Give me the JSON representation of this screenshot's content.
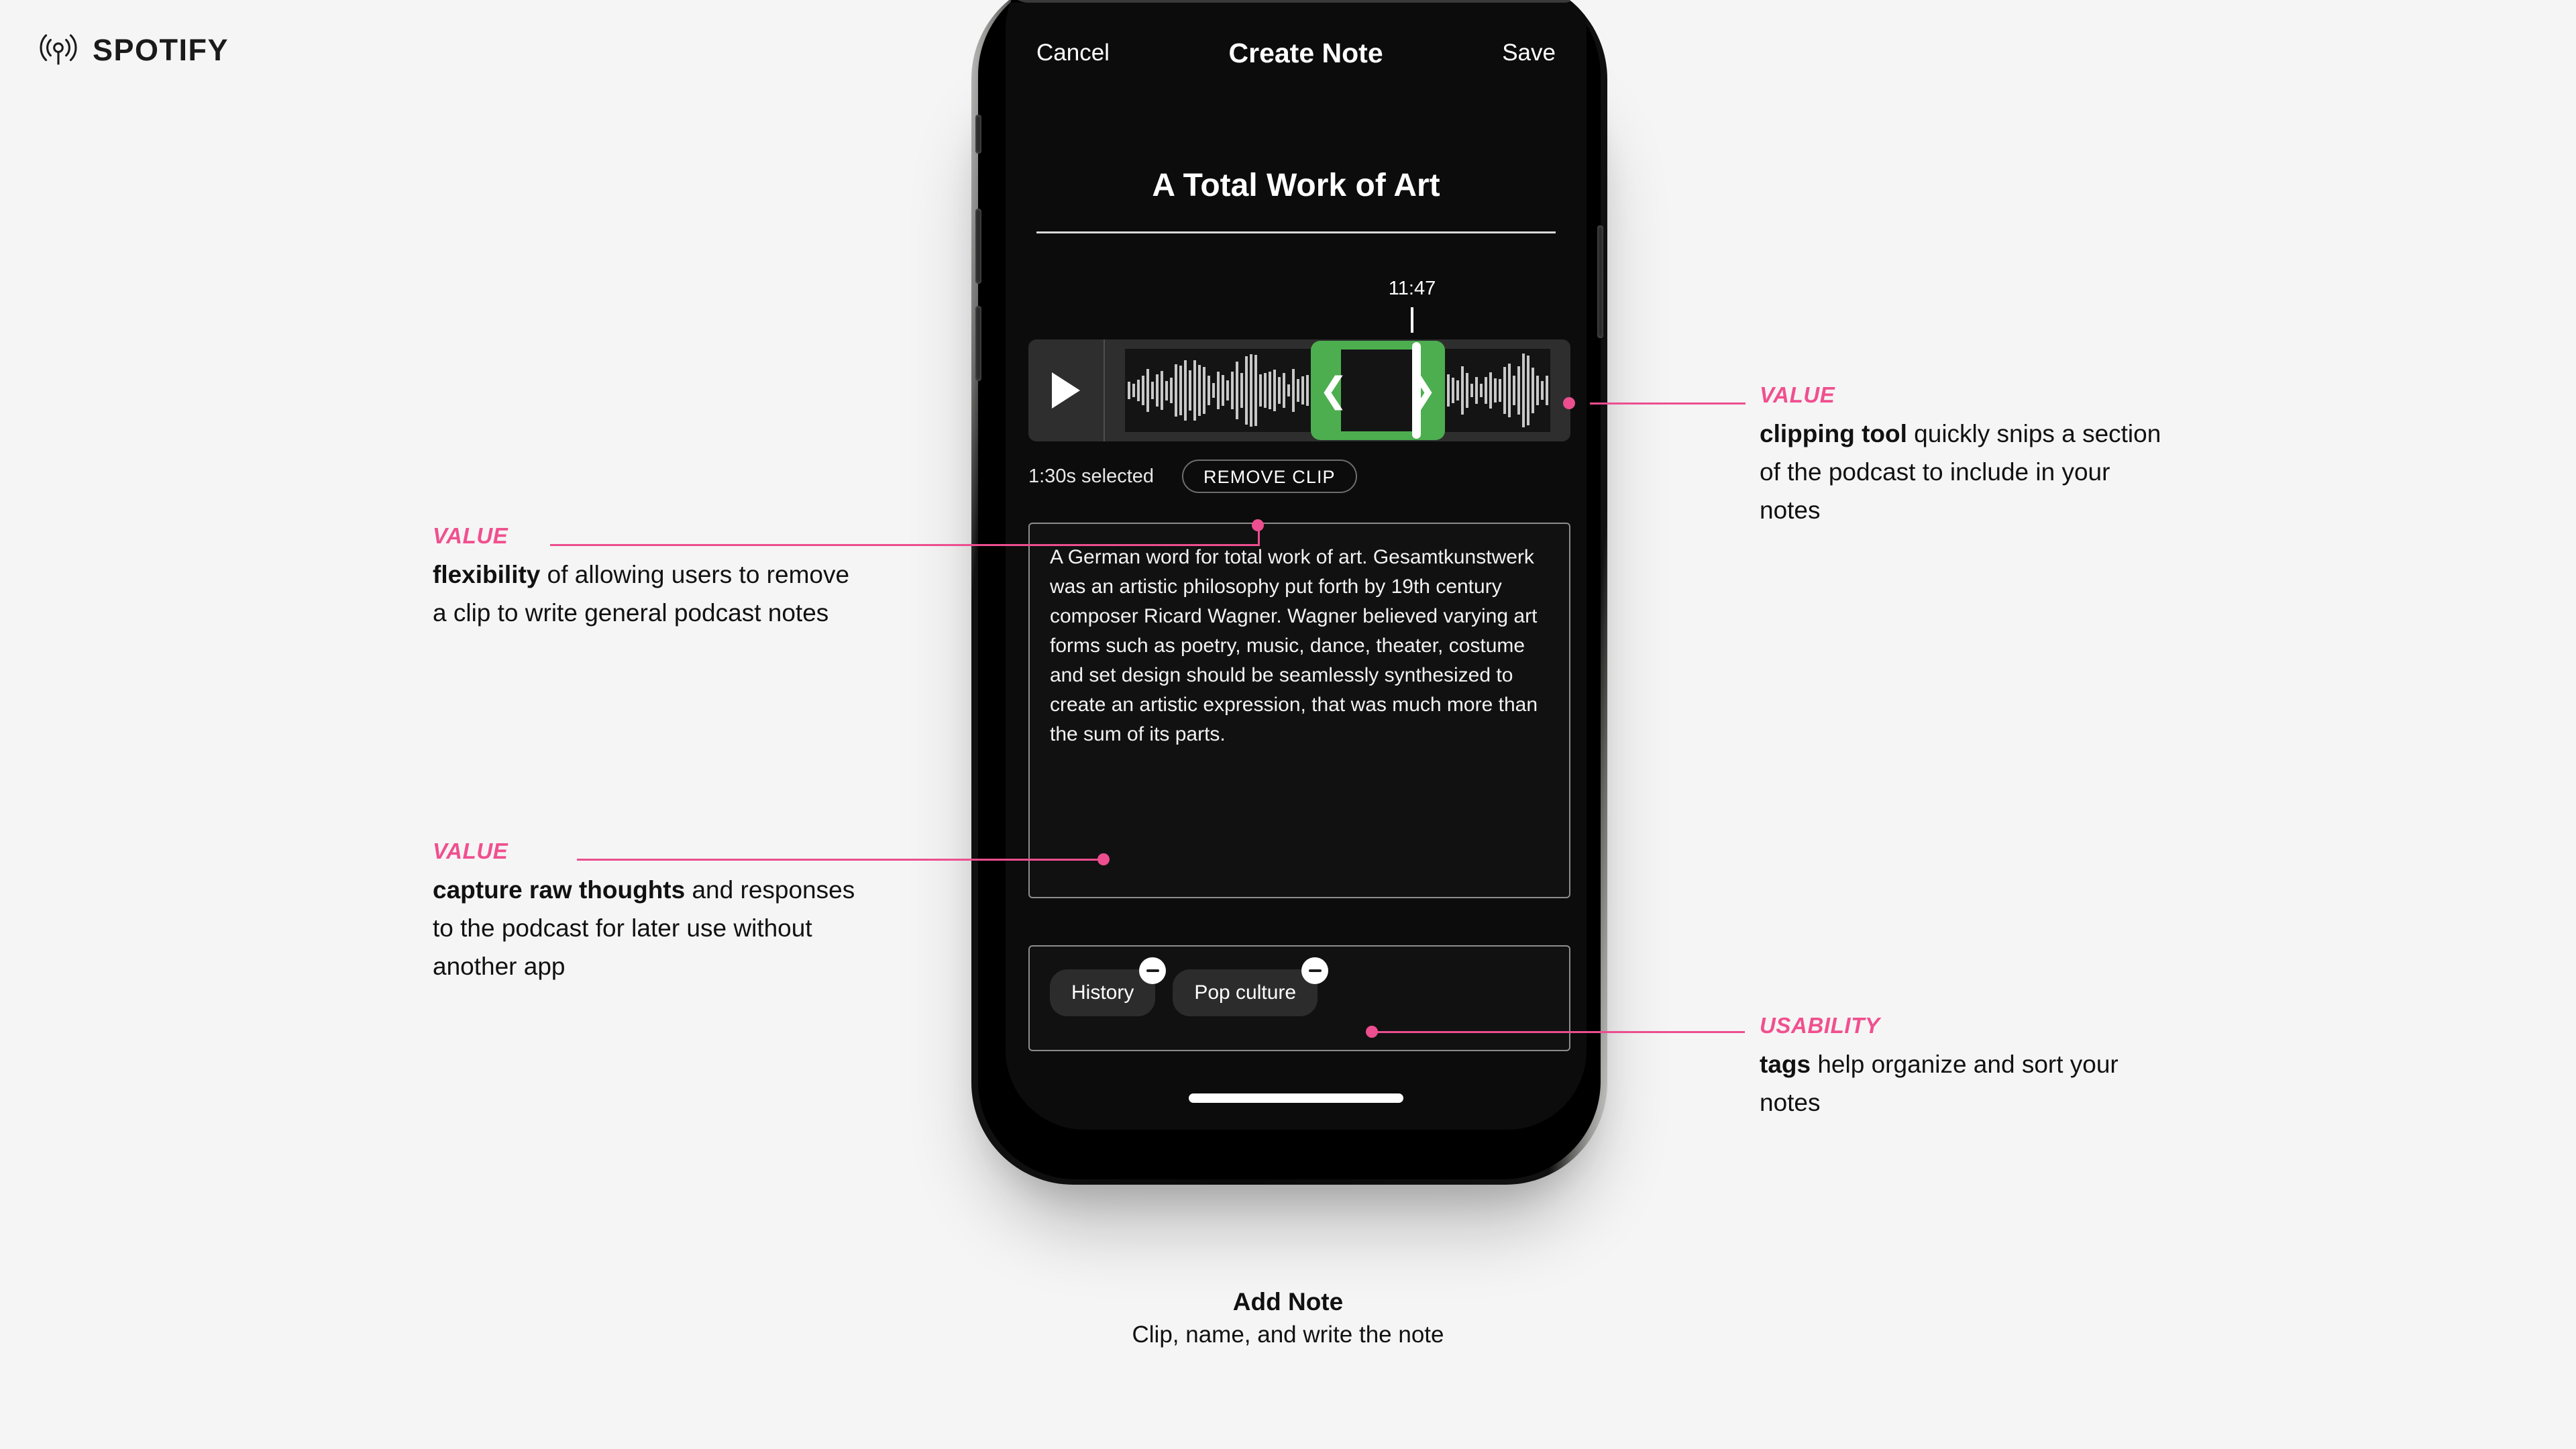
{
  "brand": {
    "wordmark": "SPOTIFY",
    "logo_icon": "podcast-broadcast-icon"
  },
  "phone": {
    "app": {
      "navbar": {
        "cancel_label": "Cancel",
        "title": "Create Note",
        "save_label": "Save"
      },
      "note_title": "A Total Work of Art",
      "player": {
        "play_icon": "play-icon",
        "playhead_time": "11:47",
        "clip_handle_left_icon": "chevron-left-icon",
        "clip_handle_right_icon": "chevron-right-icon",
        "selection_color": "#4cae4f"
      },
      "clip_meta": {
        "duration_label": "1:30s selected",
        "remove_clip_label": "REMOVE CLIP"
      },
      "note_body": "A German word for total work of art. Gesamtkunstwerk was an artistic philosophy put forth by 19th century composer Ricard Wagner. Wagner believed varying art forms such as poetry, music, dance, theater, costume and set design should be seamlessly synthesized to create an artistic expression, that was much more than the sum of its parts.",
      "tags": [
        {
          "label": "History",
          "remove_icon": "minus-circle-icon"
        },
        {
          "label": "Pop culture",
          "remove_icon": "minus-circle-icon"
        }
      ]
    }
  },
  "annotations": {
    "accent_color": "#ec4e8f",
    "clipping": {
      "kicker": "VALUE",
      "bold": "clipping tool",
      "rest": " quickly snips a section of the podcast to include in your notes"
    },
    "flexibility": {
      "kicker": "VALUE",
      "bold": "flexibility",
      "rest": " of allowing users to remove a clip to write general podcast notes"
    },
    "capture": {
      "kicker": "VALUE",
      "bold": "capture raw thoughts",
      "rest": " and responses to the podcast for later use without another app"
    },
    "tags": {
      "kicker": "USABILITY",
      "bold": "tags",
      "rest": " help organize and sort your notes"
    }
  },
  "caption": {
    "title": "Add Note",
    "subtitle": "Clip, name, and write the note"
  }
}
